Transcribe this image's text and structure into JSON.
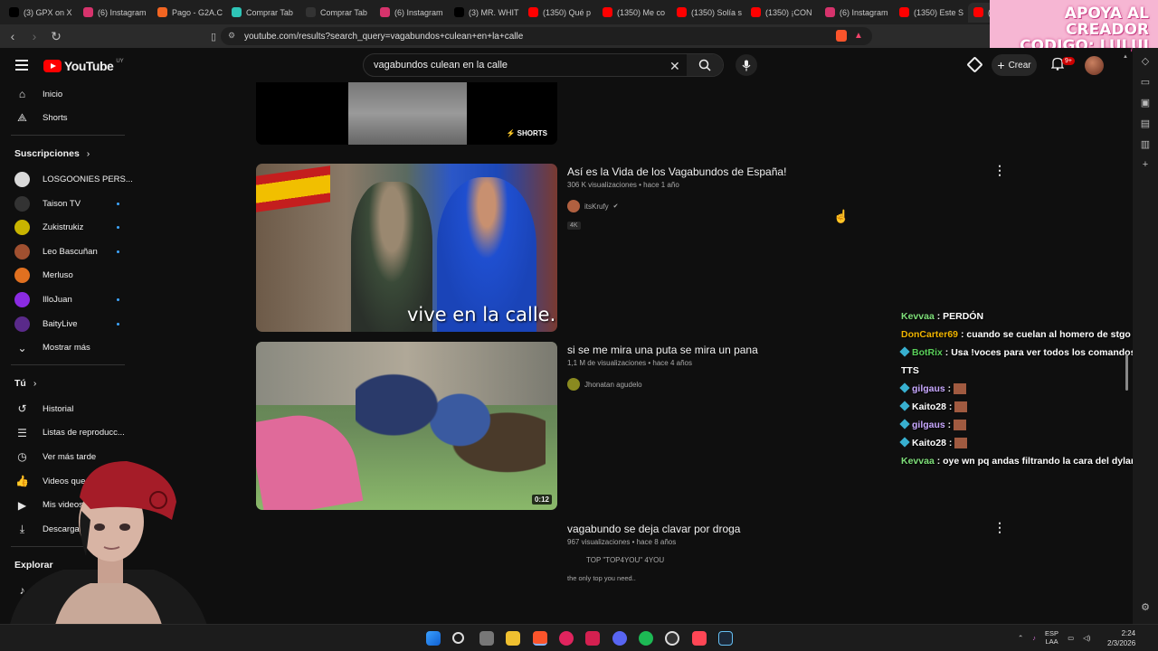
{
  "browser": {
    "tabs": [
      {
        "label": "(3) GPX on X",
        "color": "#000000",
        "icon": "x"
      },
      {
        "label": "(6) Instagram",
        "color": "#d6336c",
        "icon": "instagram"
      },
      {
        "label": "Pago - G2A.C",
        "color": "#f26522",
        "icon": "g2a"
      },
      {
        "label": "Comprar Tab",
        "color": "#2ec4b6",
        "icon": "shop"
      },
      {
        "label": "Comprar Tab",
        "color": "#333333",
        "icon": "shop"
      },
      {
        "label": "(6) Instagram",
        "color": "#d6336c",
        "icon": "instagram"
      },
      {
        "label": "(3) MR. WHIT",
        "color": "#000000",
        "icon": "x"
      },
      {
        "label": "(1350) Qué p",
        "color": "#ff0000",
        "icon": "youtube"
      },
      {
        "label": "(1350) Me co",
        "color": "#ff0000",
        "icon": "youtube"
      },
      {
        "label": "(1350) Solía s",
        "color": "#ff0000",
        "icon": "youtube"
      },
      {
        "label": "(1350) ¡CON",
        "color": "#ff0000",
        "icon": "youtube"
      },
      {
        "label": "(6) Instagram",
        "color": "#d6336c",
        "icon": "instagram"
      },
      {
        "label": "(1350) Este S",
        "color": "#ff0000",
        "icon": "youtube"
      },
      {
        "label": "(13",
        "color": "#ff0000",
        "icon": "youtube"
      }
    ],
    "url": "youtube.com/results?search_query=vagabundos+culean+en+la+calle"
  },
  "banner": {
    "line1": "APOYA AL CREADOR",
    "line2": "CODIGO: LULUI"
  },
  "youtube": {
    "logo_text": "YouTube",
    "country": "UY",
    "search_value": "vagabundos culean en la calle",
    "create_label": "Crear",
    "notifications": "9+"
  },
  "sidebar": {
    "main": [
      {
        "label": "Inicio",
        "icon": "home-icon"
      },
      {
        "label": "Shorts",
        "icon": "shorts-icon"
      }
    ],
    "subs_header": "Suscripciones",
    "subs": [
      {
        "label": "LOSGOONIES PERS...",
        "color": "#d9d9d9",
        "dot": false
      },
      {
        "label": "Taison TV",
        "color": "#333333",
        "dot": true
      },
      {
        "label": "Zukistrukiz",
        "color": "#c8b400",
        "dot": true
      },
      {
        "label": "Leo Bascuñan",
        "color": "#a05030",
        "dot": true
      },
      {
        "label": "Merluso",
        "color": "#e07020",
        "dot": false
      },
      {
        "label": "IlloJuan",
        "color": "#8a2be2",
        "dot": true
      },
      {
        "label": "BaityLive",
        "color": "#5a2a8a",
        "dot": true
      }
    ],
    "more_label": "Mostrar más",
    "you_header": "Tú",
    "you": [
      {
        "label": "Historial",
        "icon": "history-icon"
      },
      {
        "label": "Listas de reproducc...",
        "icon": "playlist-icon"
      },
      {
        "label": "Ver más tarde",
        "icon": "clock-icon"
      },
      {
        "label": "Videos que me",
        "icon": "like-icon"
      },
      {
        "label": "Mis videos",
        "icon": "video-icon"
      },
      {
        "label": "Descargas",
        "icon": "download-icon"
      }
    ],
    "explore_header": "Explorar"
  },
  "results": {
    "shorts_label": "SHORTS",
    "videos": [
      {
        "title": "Así es la Vida de los Vagabundos de España!",
        "meta": "306 K visualizaciones • hace 1 año",
        "channel": "itsKrufy",
        "verified": true,
        "badge": "4K",
        "caption": "vive en la calle."
      },
      {
        "title": "si se me mira una puta se mira un pana",
        "meta": "1,1 M de visualizaciones • hace 4 años",
        "channel": "Jhonatan agudelo",
        "duration": "0:12"
      },
      {
        "title": "vagabundo se deja clavar por droga",
        "meta": "967 visualizaciones • hace 8 años",
        "channel": "TOP \"TOP4YOU\" 4YOU",
        "description": "the only top you need.."
      }
    ]
  },
  "chat": [
    {
      "user": "Kevvaa",
      "color": "#7fe07a",
      "text": "PERDÓN"
    },
    {
      "user": "DonCarter69",
      "color": "#f0b400",
      "text": "cuando se cuelan al homero de stgo jaja"
    },
    {
      "user": "BotRix",
      "color": "#5ad05a",
      "text": "Usa !voces para ver todos los comandos del TTS"
    },
    {
      "user": "gilgaus",
      "color": "#c8a8ff",
      "text": ""
    },
    {
      "user": "Kaito28",
      "color": "#ffffff",
      "text": ""
    },
    {
      "user": "gilgaus",
      "color": "#c8a8ff",
      "text": ""
    },
    {
      "user": "Kaito28",
      "color": "#ffffff",
      "text": ""
    },
    {
      "user": "Kevvaa",
      "color": "#7fe07a",
      "text": "oye wn pq andas filtrando la cara del dylan"
    }
  ],
  "taskbar": {
    "lang": "ESP",
    "region": "LAA",
    "time": "2:24",
    "date": "2/3/2026"
  }
}
